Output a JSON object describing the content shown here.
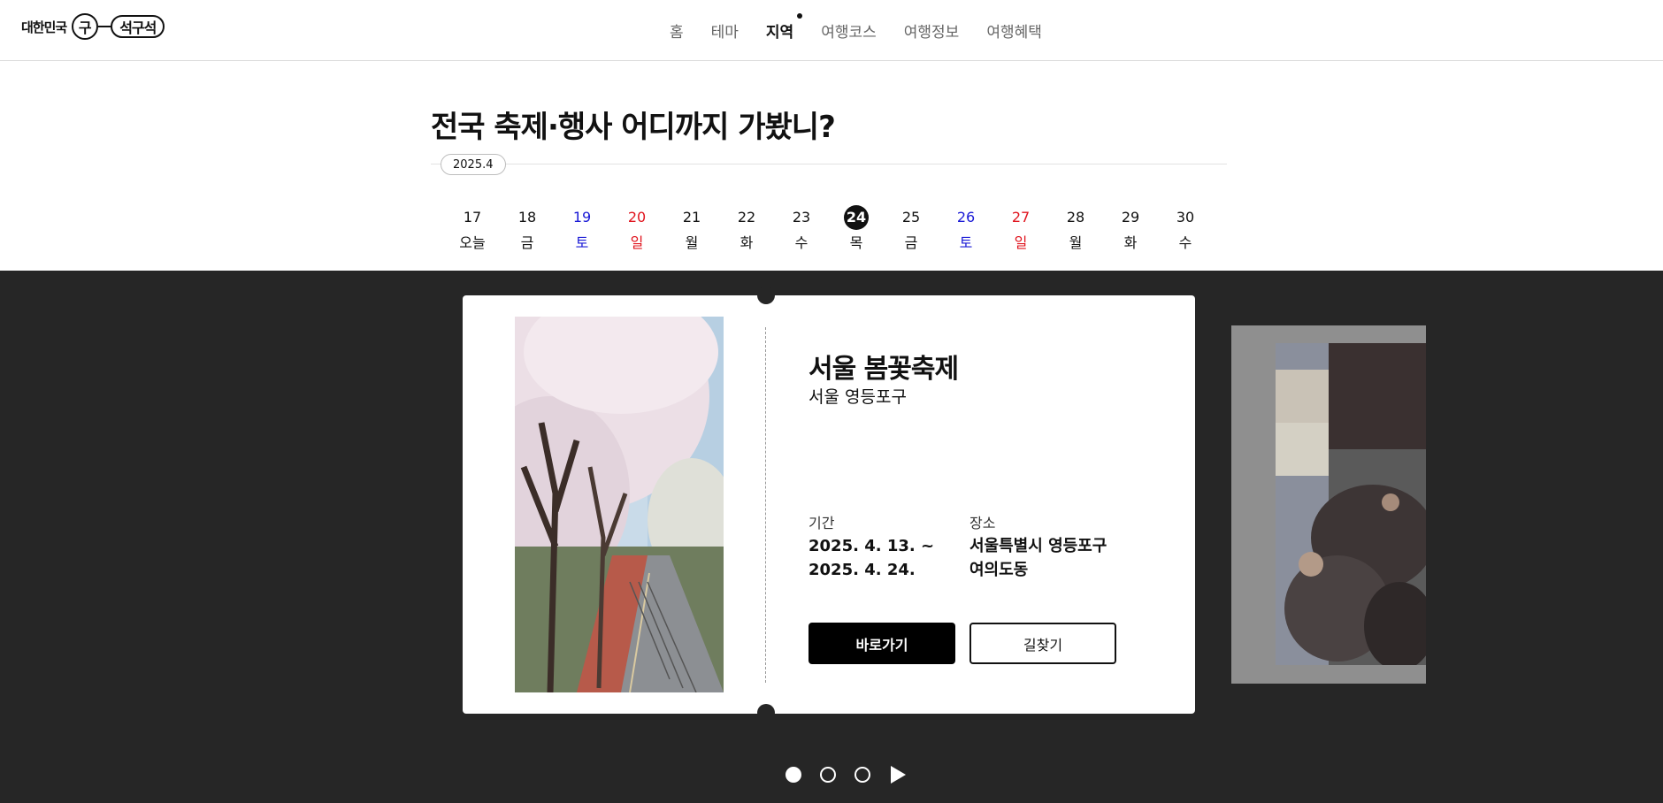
{
  "header": {
    "logo": {
      "text": "대한민국",
      "circle": "구",
      "pill": "석구석"
    },
    "nav": [
      "홈",
      "테마",
      "지역",
      "여행코스",
      "여행정보",
      "여행혜택"
    ],
    "active_nav": "지역"
  },
  "headline": {
    "bold": "전국",
    "rest": " 축제·행사 어디까지 가봤니?"
  },
  "month": "2025.4",
  "dates": [
    {
      "num": "17",
      "day": "오늘",
      "type": "weekday"
    },
    {
      "num": "18",
      "day": "금",
      "type": "weekday"
    },
    {
      "num": "19",
      "day": "토",
      "type": "sat"
    },
    {
      "num": "20",
      "day": "일",
      "type": "sun"
    },
    {
      "num": "21",
      "day": "월",
      "type": "weekday"
    },
    {
      "num": "22",
      "day": "화",
      "type": "weekday"
    },
    {
      "num": "23",
      "day": "수",
      "type": "weekday"
    },
    {
      "num": "24",
      "day": "목",
      "type": "selected"
    },
    {
      "num": "25",
      "day": "금",
      "type": "weekday"
    },
    {
      "num": "26",
      "day": "토",
      "type": "sat"
    },
    {
      "num": "27",
      "day": "일",
      "type": "sun"
    },
    {
      "num": "28",
      "day": "월",
      "type": "weekday"
    },
    {
      "num": "29",
      "day": "화",
      "type": "weekday"
    },
    {
      "num": "30",
      "day": "수",
      "type": "weekday"
    }
  ],
  "festival": {
    "title": "서울 봄꽃축제",
    "region": "서울 영등포구",
    "period_label": "기간",
    "period_value_1": "2025. 4. 13. ~",
    "period_value_2": "2025. 4. 24.",
    "place_label": "장소",
    "place_value_1": "서울특별시 영등포구",
    "place_value_2": "여의도동",
    "primary_button": "바로가기",
    "secondary_button": "길찾기"
  },
  "pager": {
    "dots": 3,
    "active_index": 0
  },
  "colors": {
    "stage_bg": "#262626",
    "saturday": "#1a1ad6",
    "sunday": "#e0141e",
    "accent": "#000000"
  }
}
